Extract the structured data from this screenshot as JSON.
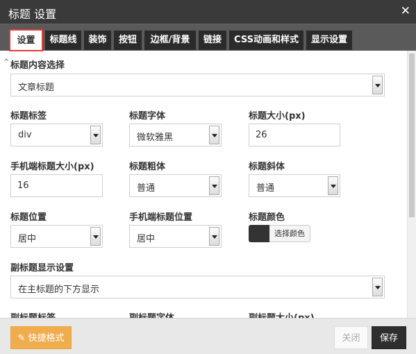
{
  "dialog": {
    "title": "标题 设置",
    "close_glyph": "✕"
  },
  "tabs": [
    {
      "label": "设置",
      "active": true
    },
    {
      "label": "标题线"
    },
    {
      "label": "装饰"
    },
    {
      "label": "按钮"
    },
    {
      "label": "边框/背景"
    },
    {
      "label": "链接"
    },
    {
      "label": "CSS动画和样式"
    },
    {
      "label": "显示设置"
    }
  ],
  "form": {
    "content_select": {
      "label": "标题内容选择",
      "value": "文章标题"
    },
    "title_tag": {
      "label": "标题标签",
      "value": "div"
    },
    "title_font": {
      "label": "标题字体",
      "value": "微软雅黑"
    },
    "title_size": {
      "label": "标题大小(px)",
      "value": "26"
    },
    "mobile_title_size": {
      "label": "手机端标题大小(px)",
      "value": "16"
    },
    "title_bold": {
      "label": "标题粗体",
      "value": "普通"
    },
    "title_italic": {
      "label": "标题斜体",
      "value": "普通"
    },
    "title_position": {
      "label": "标题位置",
      "value": "居中"
    },
    "mobile_title_position": {
      "label": "手机端标题位置",
      "value": "居中"
    },
    "title_color": {
      "label": "标题颜色",
      "button": "选择颜色",
      "color": "#333333"
    },
    "subtitle_display": {
      "label": "副标题显示设置",
      "value": "在主标题的下方显示"
    },
    "subtitle_tag": {
      "label": "副标题标签"
    },
    "subtitle_font": {
      "label": "副标题字体"
    },
    "subtitle_size": {
      "label": "副标题大小(px)"
    }
  },
  "footer": {
    "format_button": "快捷格式",
    "close_button": "关闭",
    "save_button": "保存"
  },
  "colors": {
    "titlebar": "#3a3a3a",
    "tabsbar": "#5a5a5a",
    "tab_bg": "#2b2b2b",
    "active_outline": "#e53935",
    "format_button": "#f0ad4e",
    "save_button": "#2e2e2e"
  }
}
